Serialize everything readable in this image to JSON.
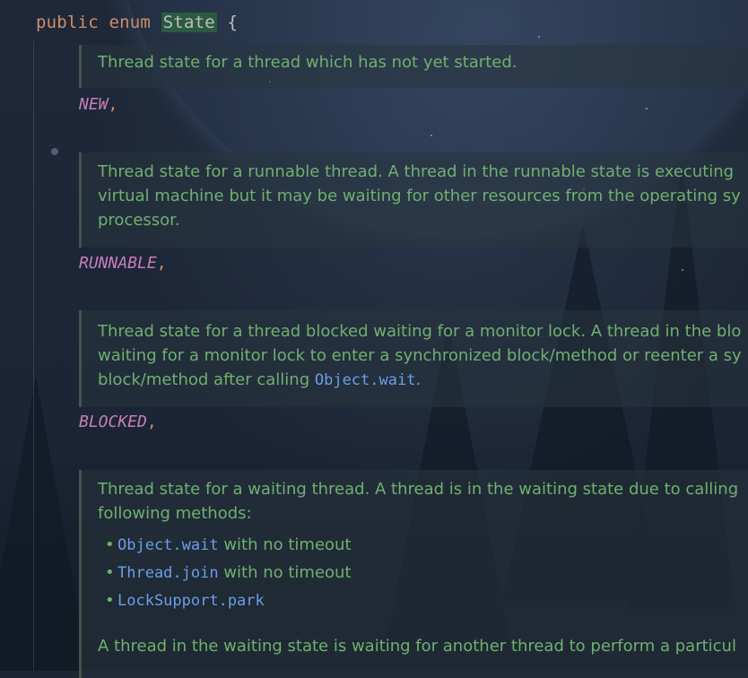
{
  "header": {
    "kw_public": "public",
    "kw_enum": "enum",
    "class_name": "State",
    "brace": "{"
  },
  "docs": [
    {
      "lines": [
        "Thread state for a thread which has not yet started."
      ]
    },
    {
      "lines": [
        "Thread state for a runnable thread. A thread in the runnable state is executing",
        "virtual machine but it may be waiting for other resources from the operating sy",
        "processor."
      ]
    },
    {
      "lines": [
        "Thread state for a thread blocked waiting for a monitor lock. A thread in the blo",
        "waiting for a monitor lock to enter a synchronized block/method or reenter a sy"
      ],
      "last_prefix": "block/method after calling ",
      "last_code": "Object.wait",
      "last_suffix": "."
    },
    {
      "lines": [
        "Thread state for a waiting thread. A thread is in the waiting state due to calling",
        "following methods:"
      ],
      "bullets": [
        {
          "code": "Object.wait",
          "text": " with no timeout"
        },
        {
          "code": "Thread.join",
          "text": " with no timeout"
        },
        {
          "code": "LockSupport.park",
          "text": ""
        }
      ],
      "trailing": "A thread in the waiting state is waiting for another thread to perform a particul"
    }
  ],
  "constants": [
    {
      "name": "NEW",
      "sep": ","
    },
    {
      "name": "RUNNABLE",
      "sep": ","
    },
    {
      "name": "BLOCKED",
      "sep": ","
    }
  ],
  "colors": {
    "keyword": "#cf8e6d",
    "constant": "#c77dbb",
    "doc_text": "#6fb06f",
    "code_ref": "#6b9ee6",
    "highlight": "#2c5a3f"
  }
}
